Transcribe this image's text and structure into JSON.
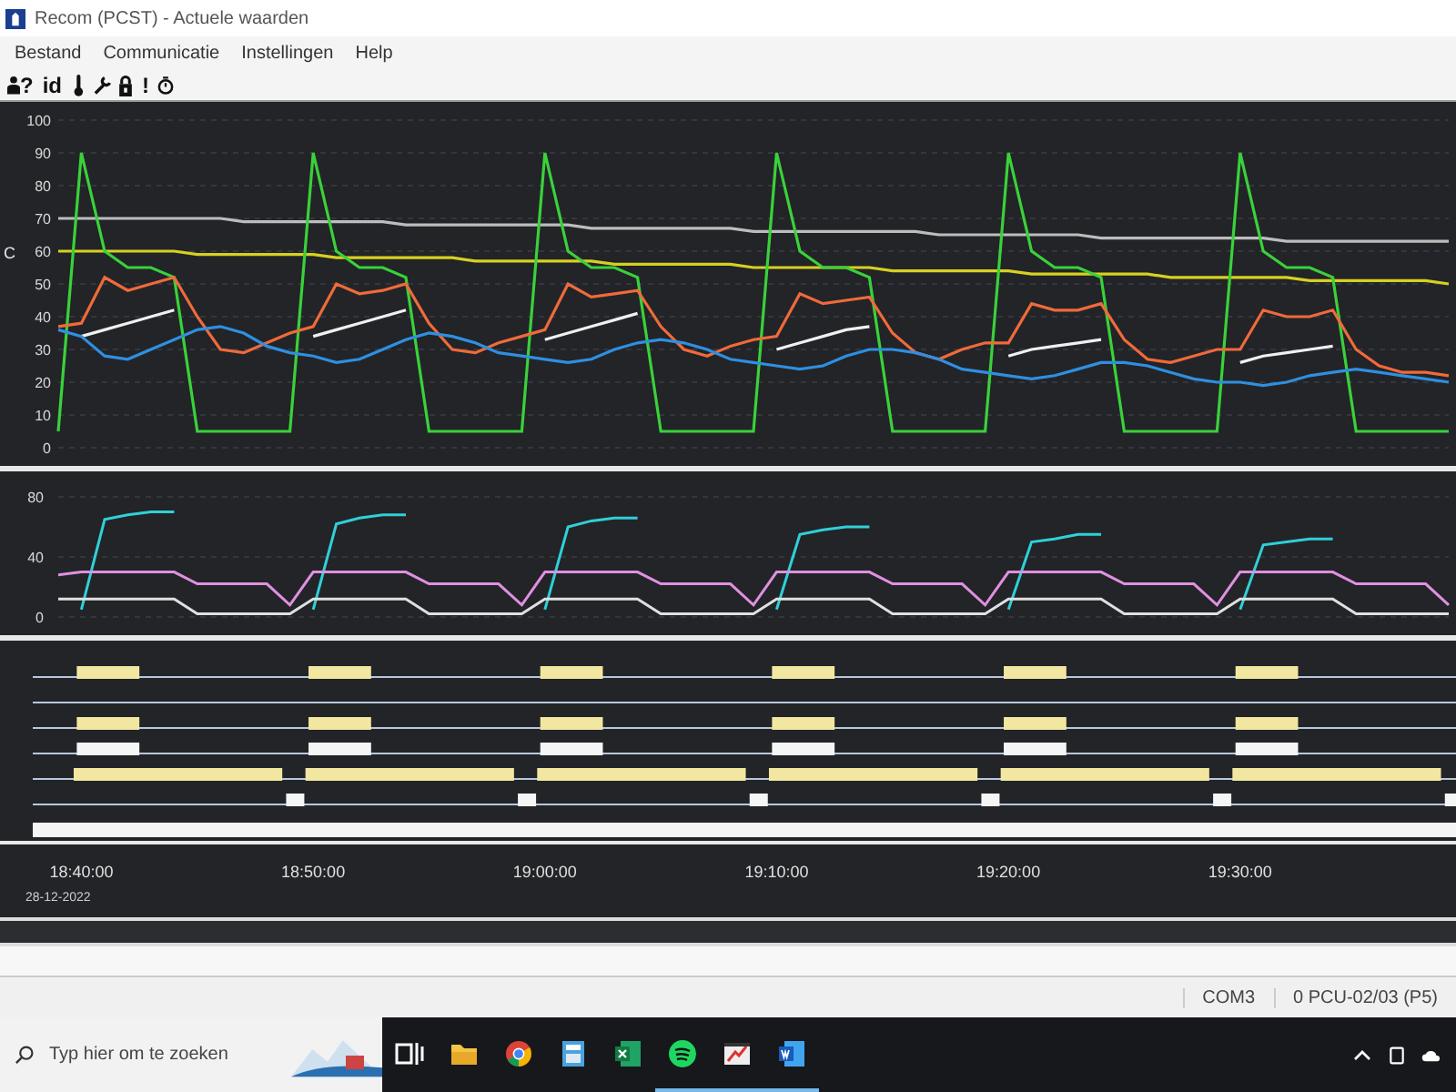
{
  "window": {
    "title": "Recom (PCST) - Actuele waarden"
  },
  "menu": [
    {
      "label": "Bestand"
    },
    {
      "label": "Communicatie"
    },
    {
      "label": "Instellingen"
    },
    {
      "label": "Help"
    }
  ],
  "toolbar": [
    {
      "kind": "user-help",
      "text": "?"
    },
    {
      "kind": "text",
      "text": "id"
    },
    {
      "kind": "thermometer"
    },
    {
      "kind": "wrench"
    },
    {
      "kind": "lock"
    },
    {
      "kind": "text",
      "text": "!"
    },
    {
      "kind": "stopwatch"
    }
  ],
  "charts": [
    {
      "unit": "C",
      "chart_data": {
        "type": "line",
        "ylim": [
          0,
          100
        ],
        "yticks": [
          0,
          10,
          20,
          30,
          40,
          50,
          60,
          70,
          80,
          90,
          100
        ],
        "grid": true,
        "series": [
          {
            "color": "#bdbdbd",
            "values": [
              70,
              70,
              70,
              70,
              70,
              70,
              70,
              70,
              69,
              69,
              69,
              69,
              69,
              69,
              69,
              68,
              68,
              68,
              68,
              68,
              68,
              68,
              68,
              67,
              67,
              67,
              67,
              67,
              67,
              67,
              66,
              66,
              66,
              66,
              66,
              66,
              66,
              66,
              65,
              65,
              65,
              65,
              65,
              65,
              65,
              64,
              64,
              64,
              64,
              64,
              64,
              64,
              64,
              63,
              63,
              63,
              63,
              63,
              63,
              63,
              63
            ]
          },
          {
            "color": "#d8d020",
            "values": [
              60,
              60,
              60,
              60,
              60,
              60,
              59,
              59,
              59,
              59,
              59,
              59,
              58,
              58,
              58,
              58,
              58,
              58,
              57,
              57,
              57,
              57,
              57,
              57,
              56,
              56,
              56,
              56,
              56,
              56,
              55,
              55,
              55,
              55,
              55,
              55,
              54,
              54,
              54,
              54,
              54,
              54,
              53,
              53,
              53,
              53,
              53,
              53,
              52,
              52,
              52,
              52,
              52,
              52,
              51,
              51,
              51,
              51,
              51,
              51,
              50
            ]
          },
          {
            "color": "#3ad13a",
            "values": [
              5,
              90,
              60,
              55,
              55,
              52,
              5,
              5,
              5,
              5,
              5,
              90,
              60,
              55,
              55,
              52,
              5,
              5,
              5,
              5,
              5,
              90,
              60,
              55,
              55,
              52,
              5,
              5,
              5,
              5,
              5,
              90,
              60,
              55,
              55,
              52,
              5,
              5,
              5,
              5,
              5,
              90,
              60,
              55,
              55,
              52,
              5,
              5,
              5,
              5,
              5,
              90,
              60,
              55,
              55,
              52,
              5,
              5,
              5,
              5,
              5
            ]
          },
          {
            "color": "#f06a3a",
            "values": [
              37,
              38,
              52,
              48,
              50,
              52,
              40,
              30,
              29,
              32,
              35,
              37,
              50,
              47,
              48,
              50,
              38,
              30,
              29,
              32,
              34,
              36,
              50,
              46,
              47,
              48,
              37,
              30,
              28,
              31,
              33,
              34,
              47,
              44,
              45,
              46,
              35,
              29,
              27,
              30,
              32,
              32,
              44,
              42,
              42,
              44,
              33,
              27,
              26,
              28,
              30,
              30,
              42,
              40,
              40,
              42,
              30,
              25,
              23,
              23,
              22
            ]
          },
          {
            "color": "#f0f0f0",
            "values": [
              null,
              34,
              36,
              38,
              40,
              42,
              null,
              null,
              null,
              null,
              null,
              34,
              36,
              38,
              40,
              42,
              null,
              null,
              null,
              null,
              null,
              33,
              35,
              37,
              39,
              41,
              null,
              null,
              null,
              null,
              null,
              30,
              32,
              34,
              36,
              37,
              null,
              null,
              null,
              null,
              null,
              28,
              30,
              31,
              32,
              33,
              null,
              null,
              null,
              null,
              null,
              26,
              28,
              29,
              30,
              31,
              null,
              null,
              null,
              null,
              null
            ]
          },
          {
            "color": "#2f8fe0",
            "values": [
              36,
              34,
              28,
              27,
              30,
              33,
              36,
              37,
              35,
              31,
              29,
              28,
              26,
              27,
              30,
              33,
              35,
              34,
              32,
              29,
              28,
              27,
              26,
              27,
              30,
              32,
              33,
              32,
              30,
              27,
              26,
              25,
              24,
              25,
              28,
              30,
              30,
              29,
              27,
              24,
              23,
              22,
              21,
              22,
              24,
              26,
              26,
              25,
              23,
              21,
              20,
              20,
              19,
              20,
              22,
              23,
              24,
              23,
              22,
              21,
              20
            ]
          }
        ]
      }
    },
    {
      "chart_data": {
        "type": "line",
        "ylim": [
          0,
          80
        ],
        "yticks": [
          0,
          40,
          80
        ],
        "grid": true,
        "series": [
          {
            "color": "#30d0d8",
            "values": [
              null,
              5,
              65,
              68,
              70,
              70,
              null,
              null,
              null,
              null,
              null,
              5,
              62,
              66,
              68,
              68,
              null,
              null,
              null,
              null,
              null,
              5,
              60,
              64,
              66,
              66,
              null,
              null,
              null,
              null,
              null,
              5,
              55,
              58,
              60,
              60,
              null,
              null,
              null,
              null,
              null,
              5,
              50,
              52,
              55,
              55,
              null,
              null,
              null,
              null,
              null,
              5,
              48,
              50,
              52,
              52,
              null,
              null,
              null,
              null,
              null
            ]
          },
          {
            "color": "#e090e0",
            "values": [
              28,
              30,
              30,
              30,
              30,
              30,
              22,
              22,
              22,
              22,
              8,
              30,
              30,
              30,
              30,
              30,
              22,
              22,
              22,
              22,
              8,
              30,
              30,
              30,
              30,
              30,
              22,
              22,
              22,
              22,
              8,
              30,
              30,
              30,
              30,
              30,
              22,
              22,
              22,
              22,
              8,
              30,
              30,
              30,
              30,
              30,
              22,
              22,
              22,
              22,
              8,
              30,
              30,
              30,
              30,
              30,
              22,
              22,
              22,
              22,
              8
            ]
          },
          {
            "color": "#e0e0e0",
            "values": [
              12,
              12,
              12,
              12,
              12,
              12,
              2,
              2,
              2,
              2,
              2,
              12,
              12,
              12,
              12,
              12,
              2,
              2,
              2,
              2,
              2,
              12,
              12,
              12,
              12,
              12,
              2,
              2,
              2,
              2,
              2,
              12,
              12,
              12,
              12,
              12,
              2,
              2,
              2,
              2,
              2,
              12,
              12,
              12,
              12,
              12,
              2,
              2,
              2,
              2,
              2,
              12,
              12,
              12,
              12,
              12,
              2,
              2,
              2,
              2,
              2
            ]
          }
        ]
      }
    }
  ],
  "time_axis": {
    "labels": [
      "18:40:00",
      "18:50:00",
      "19:00:00",
      "19:10:00",
      "19:20:00",
      "19:30:00"
    ],
    "date": "28-12-2022"
  },
  "status_bar": [
    {
      "text": "COM3"
    },
    {
      "text": "0 PCU-02/03 (P5)"
    }
  ],
  "taskbar": {
    "search": {
      "placeholder": "Typ hier om te zoeken"
    },
    "apps": [
      {
        "kind": "task-view",
        "running": false
      },
      {
        "kind": "folder",
        "running": false
      },
      {
        "kind": "browser",
        "running": false
      },
      {
        "kind": "calculator",
        "running": false
      },
      {
        "kind": "spreadsheet",
        "running": false
      },
      {
        "kind": "music",
        "running": true
      },
      {
        "kind": "recom",
        "running": true
      },
      {
        "kind": "document",
        "running": true
      }
    ]
  }
}
